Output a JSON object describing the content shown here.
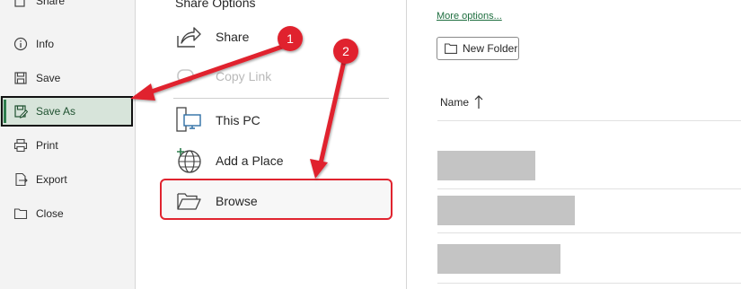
{
  "nav": {
    "share_label": "Share",
    "items": [
      {
        "label": "Info",
        "icon": "info-icon"
      },
      {
        "label": "Save",
        "icon": "save-icon"
      },
      {
        "label": "Save As",
        "icon": "save-as-icon",
        "selected": true
      },
      {
        "label": "Print",
        "icon": "print-icon"
      },
      {
        "label": "Export",
        "icon": "export-icon"
      },
      {
        "label": "Close",
        "icon": "close-folder-icon"
      }
    ]
  },
  "middle": {
    "heading": "Share Options",
    "share_label": "Share",
    "copy_link_label": "Copy Link",
    "this_pc_label": "This PC",
    "add_place_label": "Add a Place",
    "browse_label": "Browse"
  },
  "right": {
    "more_options": "More options...",
    "new_folder": "New Folder",
    "column_name": "Name"
  },
  "callouts": [
    {
      "number": "1"
    },
    {
      "number": "2"
    }
  ],
  "colors": {
    "accent_green": "#1e6e3f",
    "selected_bg": "#d7e4da",
    "annotation_red": "#e0242f",
    "placeholder_gray": "#c4c4c4"
  }
}
